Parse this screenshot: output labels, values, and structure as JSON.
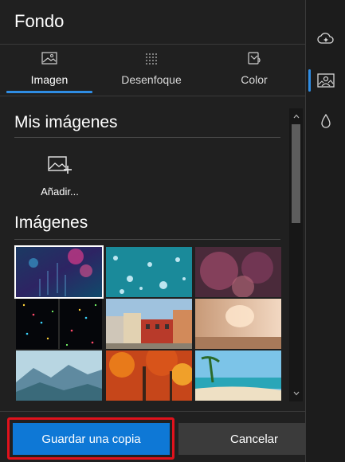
{
  "panel": {
    "title": "Fondo"
  },
  "tabs": [
    {
      "label": "Imagen",
      "icon": "image-icon",
      "active": true
    },
    {
      "label": "Desenfoque",
      "icon": "blur-icon",
      "active": false
    },
    {
      "label": "Color",
      "icon": "paint-bucket-icon",
      "active": false
    }
  ],
  "my_images": {
    "title": "Mis imágenes",
    "add_label": "Añadir...",
    "add_icon": "add-image-icon"
  },
  "gallery": {
    "title": "Imágenes",
    "thumbnails": [
      {
        "name": "rain-bokeh-thumbnail",
        "selected": true
      },
      {
        "name": "teal-droplets-thumbnail",
        "selected": false
      },
      {
        "name": "pink-blur-thumbnail",
        "selected": false
      },
      {
        "name": "space-lights-thumbnail",
        "selected": false
      },
      {
        "name": "city-street-thumbnail",
        "selected": false
      },
      {
        "name": "warm-room-thumbnail",
        "selected": false
      },
      {
        "name": "misty-mountains-thumbnail",
        "selected": false
      },
      {
        "name": "autumn-forest-thumbnail",
        "selected": false
      },
      {
        "name": "tropical-beach-thumbnail",
        "selected": false
      }
    ]
  },
  "footer": {
    "save_label": "Guardar una copia",
    "cancel_label": "Cancelar"
  },
  "rail": [
    {
      "icon": "cloud-sparkle-icon",
      "active": false
    },
    {
      "icon": "background-image-icon",
      "active": true
    },
    {
      "icon": "drop-icon",
      "active": false
    }
  ],
  "colors": {
    "accent": "#0e78d6",
    "highlight": "#e0121c",
    "background": "#202020"
  }
}
